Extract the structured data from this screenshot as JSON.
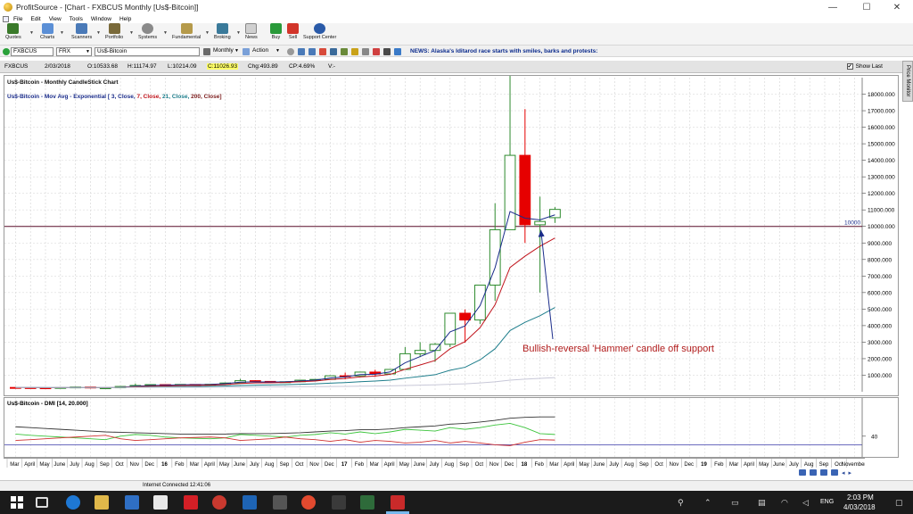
{
  "window": {
    "title": "ProfitSource - [Chart - FXBCUS Monthly [Us$-Bitcoin]]",
    "minimize": "—",
    "maximize": "☐",
    "close": "✕"
  },
  "menu": [
    "File",
    "Edit",
    "View",
    "Tools",
    "Window",
    "Help"
  ],
  "toolbar": [
    {
      "label": "Quotes",
      "icon": "quotes-icon",
      "color": "#3a7a2a"
    },
    {
      "label": "Charts",
      "icon": "charts-icon",
      "color": "#5b8fd6"
    },
    {
      "label": "Scanners",
      "icon": "scanners-icon",
      "color": "#4a7ab8"
    },
    {
      "label": "Portfolio",
      "icon": "portfolio-icon",
      "color": "#7a6a3a"
    },
    {
      "label": "Systems",
      "icon": "systems-icon",
      "color": "#8a8a8a"
    },
    {
      "label": "Fundamental",
      "icon": "fundamental-icon",
      "color": "#b59a4a"
    },
    {
      "label": "Broking",
      "icon": "broking-icon",
      "color": "#3a7a9a"
    },
    {
      "label": "News",
      "icon": "news-icon",
      "color": "#d0d0d0"
    },
    {
      "label": "Buy",
      "icon": "buy-icon",
      "color": "#2a9a3a"
    },
    {
      "label": "Sell",
      "icon": "sell-icon",
      "color": "#d2352a"
    },
    {
      "label": "Support Center",
      "icon": "support-center-icon",
      "color": "#2a5aa8"
    }
  ],
  "selector": {
    "symbol": "FXBCUS",
    "exchange": "FRX",
    "name": "Us$-Bitcoin",
    "period": "Monthly",
    "action": "Action",
    "news": "NEWS: Alaska's Iditarod race starts with smiles, barks and protests:"
  },
  "header": {
    "symbol": "FXBCUS",
    "date": "2/03/2018",
    "open": "O:10533.68",
    "high": "H:11174.97",
    "low": "L:10214.09",
    "close": "C:11026.93",
    "change": "Chg:493.89",
    "change_pct": "CP:4.69%",
    "volume": "V:-",
    "show_last": "Show Last",
    "show_last_checked": "✔"
  },
  "side_tab": "Price Monitor",
  "chart": {
    "overlay_title": "Us$-Bitcoin - Monthly CandleStick Chart",
    "ma_legend_prefix": "Us$-Bitcoin - Mov Avg - Exponential [",
    "ma_3": "3, Close,",
    "ma_7": "7, Close,",
    "ma_21": "21, Close,",
    "ma_200": "200, Close]",
    "level_label": "10000",
    "annotation": "Bullish-reversal 'Hammer' candle off support",
    "dmi_title": "Us$-Bitcoin - DMI [14, 20.000]",
    "dmi_axis_label": "40",
    "colors": {
      "bull": "#2e8b2e",
      "bear": "#e60000",
      "ma3": "#1a2c8a",
      "ma7": "#c0141c",
      "ma21": "#1d7d8b",
      "ma200": "#7a1a1a",
      "level": "#5a0f2a",
      "annotation": "#1a2c8a"
    }
  },
  "chart_data": {
    "type": "candlestick",
    "title": "Us$-Bitcoin - Monthly CandleStick Chart",
    "yticks": [
      "1000.000",
      "2000.000",
      "3000.000",
      "4000.000",
      "5000.000",
      "6000.000",
      "7000.000",
      "8000.000",
      "9000.000",
      "10000.000",
      "11000.000",
      "12000.000",
      "13000.000",
      "14000.000",
      "15000.000",
      "16000.000",
      "17000.000",
      "18000.000"
    ],
    "ylim": [
      0,
      19000
    ],
    "horizontal_level": 10000,
    "x_labels": [
      "Mar",
      "April",
      "May",
      "June",
      "July",
      "Aug",
      "Sep",
      "Oct",
      "Nov",
      "Dec",
      "16",
      "Feb",
      "Mar",
      "April",
      "May",
      "June",
      "July",
      "Aug",
      "Sep",
      "Oct",
      "Nov",
      "Dec",
      "17",
      "Feb",
      "Mar",
      "April",
      "May",
      "June",
      "July",
      "Aug",
      "Sep",
      "Oct",
      "Nov",
      "Dec",
      "18",
      "Feb",
      "Mar",
      "April",
      "May",
      "June",
      "July",
      "Aug",
      "Sep",
      "Oct",
      "Nov",
      "Dec",
      "19",
      "Feb",
      "Mar",
      "April",
      "May",
      "June",
      "July",
      "Aug",
      "Sep",
      "Oct",
      "November"
    ],
    "candles": [
      {
        "o": 260,
        "h": 290,
        "l": 240,
        "c": 250
      },
      {
        "o": 250,
        "h": 260,
        "l": 230,
        "c": 240
      },
      {
        "o": 240,
        "h": 250,
        "l": 225,
        "c": 235
      },
      {
        "o": 235,
        "h": 265,
        "l": 225,
        "c": 260
      },
      {
        "o": 260,
        "h": 320,
        "l": 260,
        "c": 290
      },
      {
        "o": 290,
        "h": 300,
        "l": 200,
        "c": 230
      },
      {
        "o": 230,
        "h": 250,
        "l": 220,
        "c": 240
      },
      {
        "o": 240,
        "h": 330,
        "l": 240,
        "c": 320
      },
      {
        "o": 320,
        "h": 500,
        "l": 320,
        "c": 380
      },
      {
        "o": 380,
        "h": 460,
        "l": 360,
        "c": 430
      },
      {
        "o": 430,
        "h": 460,
        "l": 360,
        "c": 370
      },
      {
        "o": 370,
        "h": 440,
        "l": 370,
        "c": 440
      },
      {
        "o": 440,
        "h": 440,
        "l": 390,
        "c": 420
      },
      {
        "o": 420,
        "h": 460,
        "l": 420,
        "c": 450
      },
      {
        "o": 450,
        "h": 560,
        "l": 440,
        "c": 530
      },
      {
        "o": 530,
        "h": 780,
        "l": 530,
        "c": 670
      },
      {
        "o": 670,
        "h": 700,
        "l": 600,
        "c": 625
      },
      {
        "o": 625,
        "h": 630,
        "l": 520,
        "c": 575
      },
      {
        "o": 575,
        "h": 610,
        "l": 560,
        "c": 605
      },
      {
        "o": 605,
        "h": 720,
        "l": 600,
        "c": 700
      },
      {
        "o": 700,
        "h": 760,
        "l": 700,
        "c": 745
      },
      {
        "o": 745,
        "h": 980,
        "l": 740,
        "c": 965
      },
      {
        "o": 965,
        "h": 1160,
        "l": 750,
        "c": 960
      },
      {
        "o": 960,
        "h": 1200,
        "l": 930,
        "c": 1190
      },
      {
        "o": 1190,
        "h": 1330,
        "l": 900,
        "c": 1080
      },
      {
        "o": 1080,
        "h": 1350,
        "l": 1080,
        "c": 1350
      },
      {
        "o": 1350,
        "h": 2700,
        "l": 1350,
        "c": 2300
      },
      {
        "o": 2300,
        "h": 3000,
        "l": 2100,
        "c": 2500
      },
      {
        "o": 2500,
        "h": 2950,
        "l": 1800,
        "c": 2870
      },
      {
        "o": 2870,
        "h": 4750,
        "l": 2700,
        "c": 4750
      },
      {
        "o": 4750,
        "h": 4980,
        "l": 2970,
        "c": 4340
      },
      {
        "o": 4340,
        "h": 6450,
        "l": 4100,
        "c": 6450
      },
      {
        "o": 6450,
        "h": 11400,
        "l": 5500,
        "c": 9800
      },
      {
        "o": 9800,
        "h": 19800,
        "l": 9800,
        "c": 14300
      },
      {
        "o": 14300,
        "h": 17100,
        "l": 9000,
        "c": 10100
      },
      {
        "o": 10100,
        "h": 11800,
        "l": 6000,
        "c": 10300
      },
      {
        "o": 10530,
        "h": 11170,
        "l": 10210,
        "c": 11030
      }
    ],
    "moving_averages": [
      {
        "name": "3",
        "values": [
          260,
          255,
          245,
          245,
          265,
          250,
          245,
          280,
          330,
          380,
          400,
          420,
          430,
          440,
          490,
          580,
          600,
          590,
          600,
          650,
          700,
          830,
          900,
          1040,
          1060,
          1200,
          1750,
          2130,
          2500,
          3620,
          3980,
          5210,
          7500,
          10900,
          10500,
          10400,
          10700
        ]
      },
      {
        "name": "7",
        "values": [
          260,
          258,
          252,
          250,
          260,
          252,
          250,
          268,
          300,
          330,
          345,
          370,
          385,
          400,
          435,
          500,
          530,
          540,
          560,
          610,
          650,
          740,
          800,
          900,
          950,
          1050,
          1360,
          1620,
          1890,
          2600,
          3030,
          3880,
          5260,
          7520,
          8200,
          8800,
          9300
        ]
      },
      {
        "name": "21",
        "values": [
          260,
          260,
          258,
          257,
          259,
          257,
          255,
          260,
          270,
          285,
          295,
          305,
          318,
          330,
          348,
          378,
          398,
          412,
          428,
          452,
          476,
          518,
          556,
          610,
          645,
          700,
          820,
          925,
          1030,
          1300,
          1480,
          1930,
          2600,
          3700,
          4200,
          4600,
          5100
        ]
      },
      {
        "name": "200",
        "values": [
          260,
          260,
          260,
          260,
          260,
          260,
          260,
          260,
          262,
          265,
          268,
          270,
          273,
          276,
          280,
          286,
          290,
          294,
          298,
          304,
          310,
          318,
          326,
          336,
          344,
          355,
          375,
          395,
          415,
          450,
          480,
          530,
          600,
          700,
          760,
          810,
          860
        ]
      }
    ],
    "dmi": {
      "adx": [
        62,
        60,
        58,
        56,
        54,
        52,
        50,
        49,
        48,
        47,
        46,
        45,
        45,
        45,
        45,
        46,
        46,
        46,
        47,
        48,
        50,
        52,
        53,
        55,
        55,
        57,
        60,
        62,
        64,
        68,
        70,
        73,
        77,
        82,
        84,
        85,
        85
      ],
      "plus_di": [
        45,
        42,
        40,
        38,
        36,
        34,
        32,
        40,
        44,
        42,
        38,
        36,
        35,
        34,
        36,
        44,
        42,
        40,
        38,
        42,
        44,
        48,
        45,
        50,
        46,
        50,
        56,
        54,
        52,
        60,
        56,
        60,
        66,
        70,
        60,
        46,
        44
      ],
      "minus_di": [
        30,
        32,
        34,
        36,
        38,
        40,
        42,
        34,
        30,
        32,
        34,
        36,
        37,
        38,
        36,
        30,
        32,
        34,
        38,
        34,
        32,
        28,
        32,
        26,
        30,
        28,
        24,
        26,
        30,
        24,
        28,
        24,
        20,
        18,
        26,
        32,
        31
      ]
    }
  },
  "status": {
    "text": "Internet Connected 12:41:06"
  },
  "taskbar": {
    "time": "2:03 PM",
    "date": "4/03/2018",
    "lang": "ENG"
  }
}
